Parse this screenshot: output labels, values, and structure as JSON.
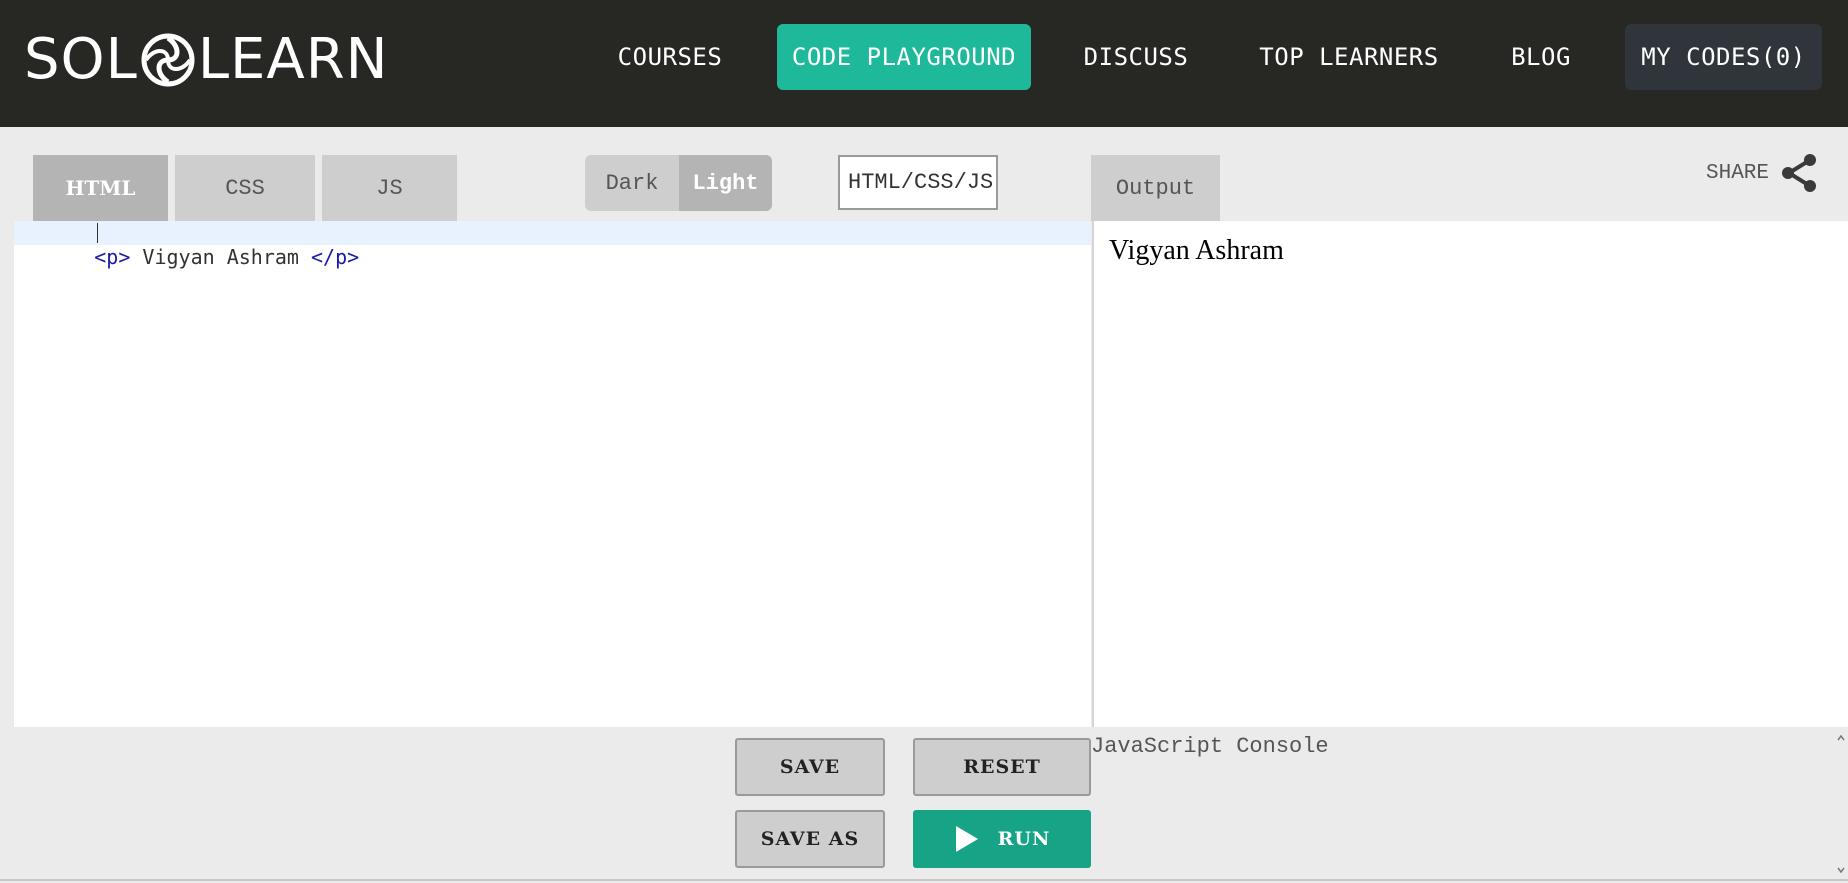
{
  "header": {
    "logo_left": "SOL",
    "logo_right": "LEARN",
    "nav": {
      "courses": "COURSES",
      "code_playground": "CODE PLAYGROUND",
      "discuss": "DISCUSS",
      "top_learners": "TOP LEARNERS",
      "blog": "BLOG",
      "my_codes": "MY CODES(0)"
    },
    "colors": {
      "background": "#272723",
      "active_nav": "#1eb89a",
      "my_codes_bg": "#2f353a"
    }
  },
  "toolbar": {
    "tabs": {
      "html": "HTML",
      "css": "CSS",
      "js": "JS"
    },
    "active_tab": "HTML",
    "theme": {
      "dark": "Dark",
      "light": "Light",
      "selected": "Light"
    },
    "language": "HTML/CSS/JS",
    "output_tab": "Output",
    "share": "SHARE"
  },
  "editor": {
    "line1": {
      "open_tag": "<p>",
      "text": " Vigyan Ashram ",
      "close_tag": "</p>"
    }
  },
  "output": {
    "text": "Vigyan Ashram"
  },
  "actions": {
    "save": "SAVE",
    "reset": "RESET",
    "save_as": "SAVE AS",
    "run": "RUN",
    "run_color": "#16a386"
  },
  "console": {
    "label": "JavaScript Console"
  }
}
